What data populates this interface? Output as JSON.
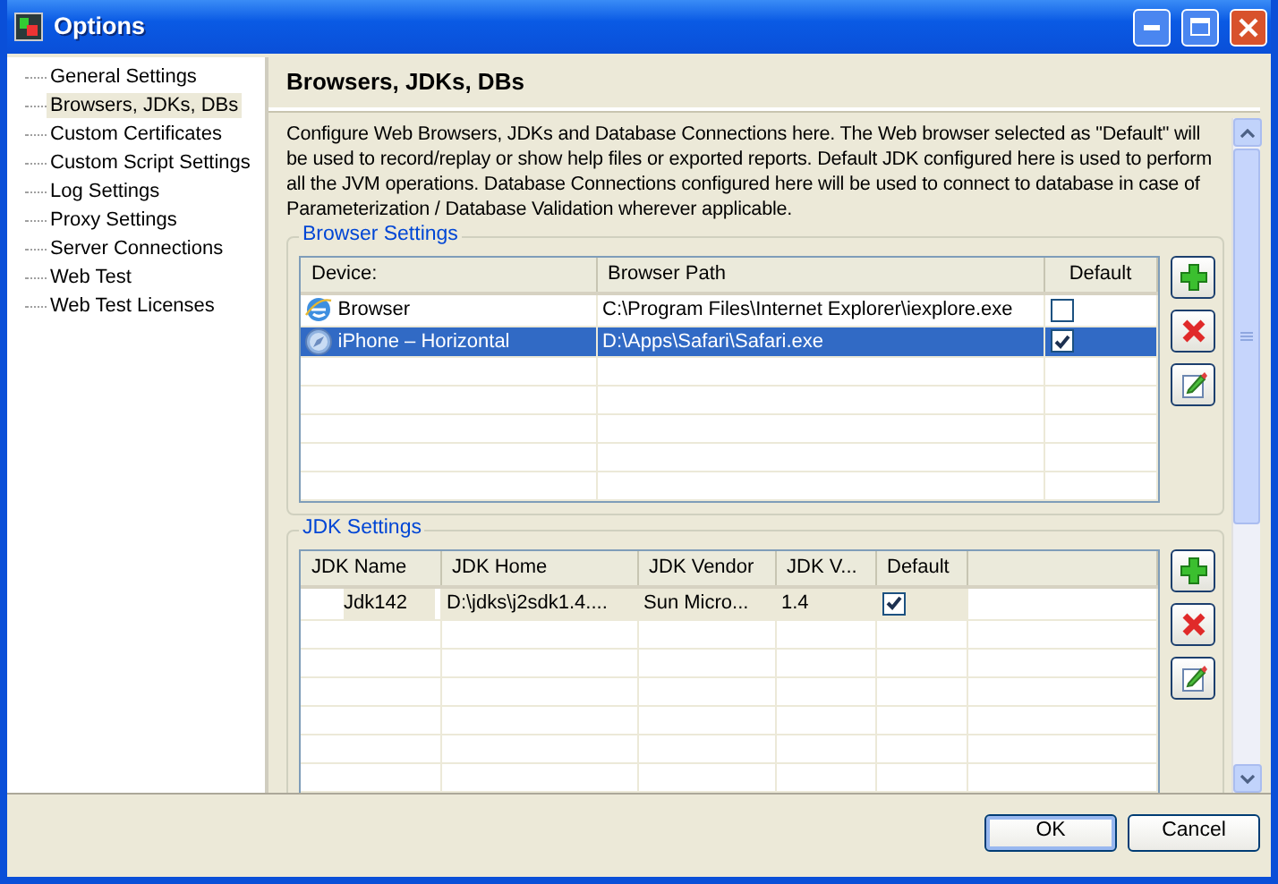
{
  "window": {
    "title": "Options"
  },
  "sidebar": {
    "items": [
      {
        "label": "General Settings",
        "selected": false
      },
      {
        "label": "Browsers, JDKs, DBs",
        "selected": true
      },
      {
        "label": "Custom Certificates",
        "selected": false
      },
      {
        "label": "Custom Script Settings",
        "selected": false
      },
      {
        "label": "Log Settings",
        "selected": false
      },
      {
        "label": "Proxy Settings",
        "selected": false
      },
      {
        "label": "Server Connections",
        "selected": false
      },
      {
        "label": "Web Test",
        "selected": false
      },
      {
        "label": "Web Test Licenses",
        "selected": false
      }
    ]
  },
  "panel": {
    "title": "Browsers, JDKs, DBs",
    "description": "Configure Web Browsers, JDKs and Database Connections here. The Web browser selected as \"Default\" will be used to record/replay or show help files or exported reports. Default JDK configured here is used to perform all the JVM operations. Database Connections configured here will be used to connect to database in case of Parameterization / Database Validation wherever applicable.",
    "browser_settings": {
      "title": "Browser Settings",
      "columns": [
        "Device:",
        "Browser Path",
        "Default"
      ],
      "rows": [
        {
          "device": "Browser",
          "path": "C:\\Program Files\\Internet Explorer\\iexplore.exe",
          "default": false,
          "selected": false
        },
        {
          "device": "iPhone – Horizontal",
          "path": "D:\\Apps\\Safari\\Safari.exe",
          "default": true,
          "selected": true
        }
      ]
    },
    "jdk_settings": {
      "title": "JDK Settings",
      "columns": [
        "JDK Name",
        "JDK Home",
        "JDK Vendor",
        "JDK V...",
        "Default"
      ],
      "rows": [
        {
          "name": "Jdk142",
          "home": "D:\\jdks\\j2sdk1.4....",
          "vendor": "Sun Micro...",
          "version": "1.4",
          "default": true,
          "selected": true
        }
      ]
    }
  },
  "buttons": [
    "OK",
    "Cancel"
  ]
}
